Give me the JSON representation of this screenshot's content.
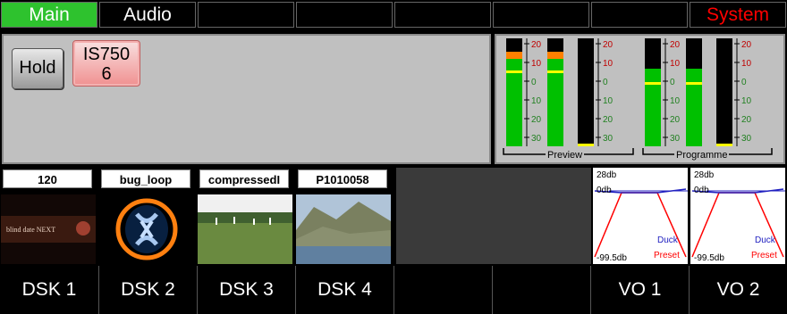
{
  "top_tabs": [
    "Main",
    "Audio",
    "",
    "",
    "",
    "",
    "",
    "System"
  ],
  "main_panel": {
    "hold_label": "Hold",
    "source_label_line1": "IS750",
    "source_label_line2": "6"
  },
  "meters": {
    "scale_ticks": [
      "20",
      "10",
      "0",
      "10",
      "20",
      "30"
    ],
    "preview_label": "Preview",
    "programme_label": "Programme",
    "levels": [
      0.88,
      0.88,
      0.0,
      0.72,
      0.72,
      0.0
    ]
  },
  "dsk_sources": [
    {
      "name": "120",
      "thumb": "blind-date-logo",
      "thumb_text": "blind date NEXT"
    },
    {
      "name": "bug_loop",
      "thumb": "x-logo"
    },
    {
      "name": "compressedI",
      "thumb": "cricket-field"
    },
    {
      "name": "P1010058",
      "thumb": "mountain-lake"
    }
  ],
  "vo_graphs": [
    {
      "top_label": "28db",
      "mid_label": "0db",
      "bottom_label": "-99.5db",
      "duck_label": "Duck",
      "preset_label": "Preset"
    },
    {
      "top_label": "28db",
      "mid_label": "0db",
      "bottom_label": "-99.5db",
      "duck_label": "Duck",
      "preset_label": "Preset"
    }
  ],
  "bottom_buttons": [
    "DSK 1",
    "DSK 2",
    "DSK 3",
    "DSK 4",
    "",
    "",
    "VO 1",
    "VO 2"
  ],
  "colors": {
    "active_tab": "#2ec22e",
    "system_text": "#ff0000",
    "meter_green": "#00c000",
    "meter_orange": "#ff8000",
    "meter_peak": "#ffff00"
  }
}
